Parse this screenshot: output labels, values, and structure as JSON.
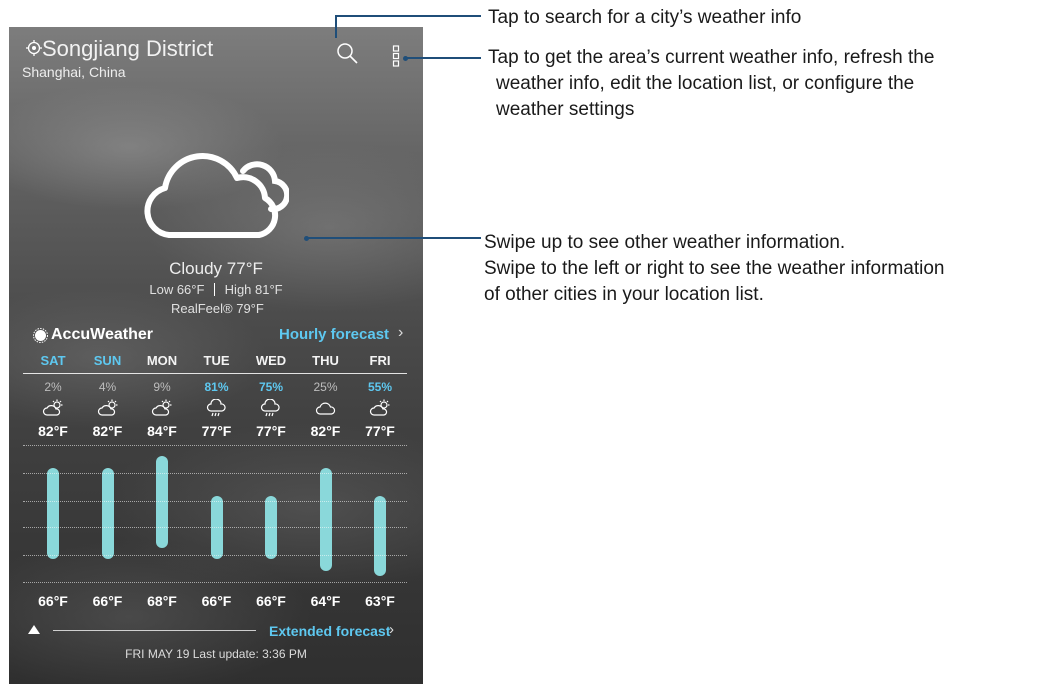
{
  "header": {
    "city": "Songjiang District",
    "region": "Shanghai, China",
    "icons": [
      "location-icon",
      "search-icon",
      "menu-icon"
    ]
  },
  "current": {
    "condition": "Cloudy",
    "temp": "77°F",
    "low": "Low 66°F",
    "high": "High 81°F",
    "realfeel": "RealFeel® 79°F",
    "icon": "cloudy-icon"
  },
  "forecast_bar": {
    "brand": "AccuWeather",
    "hourly_label": "Hourly forecast",
    "chevron": "›"
  },
  "days": [
    {
      "label": "SAT",
      "precip": "2%",
      "icon": "partly-sunny-icon",
      "high": "82°F",
      "low": "66°F",
      "high_f": 82,
      "low_f": 66
    },
    {
      "label": "SUN",
      "precip": "4%",
      "icon": "partly-sunny-icon",
      "high": "82°F",
      "low": "66°F",
      "high_f": 82,
      "low_f": 66
    },
    {
      "label": "MON",
      "precip": "9%",
      "icon": "partly-sunny-icon",
      "high": "84°F",
      "low": "68°F",
      "high_f": 84,
      "low_f": 68
    },
    {
      "label": "TUE",
      "precip": "81%",
      "icon": "rain-icon",
      "high": "77°F",
      "low": "66°F",
      "high_f": 77,
      "low_f": 66
    },
    {
      "label": "WED",
      "precip": "75%",
      "icon": "rain-icon",
      "high": "77°F",
      "low": "66°F",
      "high_f": 77,
      "low_f": 66
    },
    {
      "label": "THU",
      "precip": "25%",
      "icon": "cloud-icon",
      "high": "82°F",
      "low": "64°F",
      "high_f": 82,
      "low_f": 64
    },
    {
      "label": "FRI",
      "precip": "55%",
      "icon": "partly-sunny-icon",
      "high": "77°F",
      "low": "63°F",
      "high_f": 77,
      "low_f": 63
    }
  ],
  "footer": {
    "extended_label": "Extended forecast",
    "chevron": "›",
    "updated": "FRI MAY 19 Last update: 3:36 PM"
  },
  "callouts": {
    "search": "Tap to search for a city’s weather info",
    "menu": [
      "Tap to get the area’s current weather info, refresh the",
      "weather info, edit the location list, or configure the",
      "weather settings"
    ],
    "swipe": [
      "Swipe up to see other weather information.",
      "Swipe to the left or right to see the weather information",
      "of other cities in your location list."
    ]
  },
  "colors": {
    "accent": "#5ec8f0",
    "bar": "#8ad8da",
    "callout_line": "#1f4e79"
  }
}
